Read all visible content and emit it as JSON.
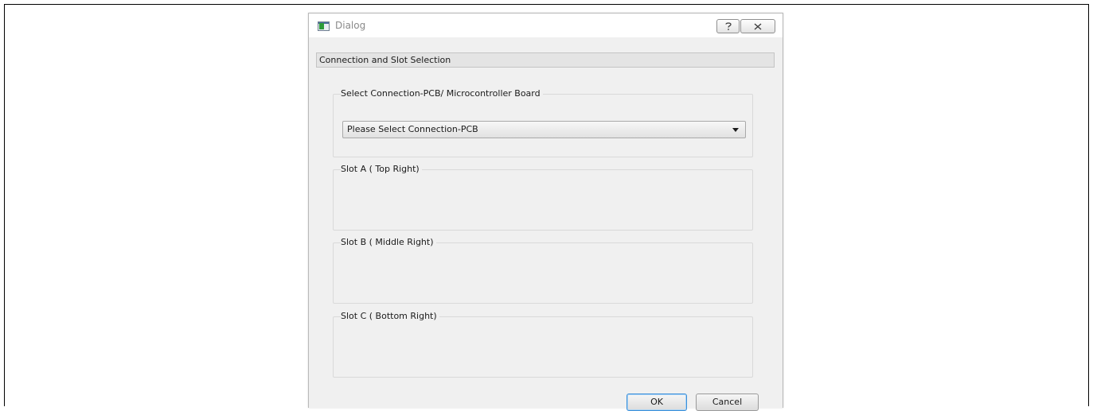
{
  "dialog": {
    "title": "Dialog",
    "header": "Connection and Slot Selection",
    "groups": [
      {
        "title": "Select Connection-PCB/ Microcontroller Board"
      },
      {
        "title": "Slot A  ( Top Right)"
      },
      {
        "title": "Slot B  ( Middle Right)"
      },
      {
        "title": "Slot C  ( Bottom Right)"
      }
    ],
    "combo": {
      "selected": "Please Select Connection-PCB"
    },
    "buttons": {
      "ok": "OK",
      "cancel": "Cancel"
    },
    "titlebar_icons": {
      "help": "help-icon",
      "close": "close-icon"
    }
  }
}
